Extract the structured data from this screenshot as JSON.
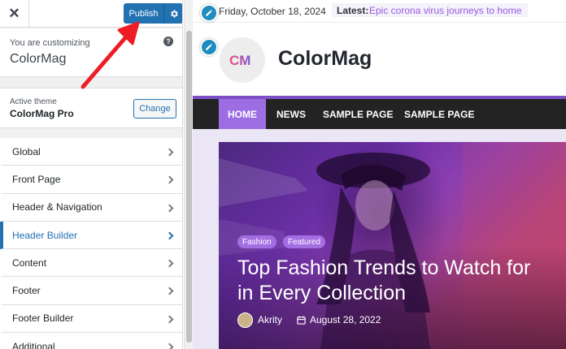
{
  "sidebar": {
    "close_icon": "close-icon",
    "publish_label": "Publish",
    "publish_settings_icon": "gear-icon",
    "customizing_label": "You are customizing",
    "site_name": "ColorMag",
    "help_icon": "help-icon",
    "active_theme_label": "Active theme",
    "theme_name": "ColorMag Pro",
    "change_label": "Change",
    "menu": [
      {
        "label": "Global"
      },
      {
        "label": "Front Page"
      },
      {
        "label": "Header & Navigation"
      },
      {
        "label": "Header Builder",
        "active": true
      },
      {
        "label": "Content"
      },
      {
        "label": "Footer"
      },
      {
        "label": "Footer Builder"
      },
      {
        "label": "Additional"
      }
    ]
  },
  "preview": {
    "date": "Friday, October 18, 2024",
    "latest_label": "Latest:",
    "latest_link": "Epic corona virus journeys to home",
    "site_title": "ColorMag",
    "logo_letters": "CM",
    "nav": [
      "HOME",
      "NEWS",
      "SAMPLE PAGE",
      "SAMPLE PAGE"
    ],
    "hero": {
      "tags": [
        "Fashion",
        "Featured"
      ],
      "title": "Top Fashion Trends to Watch for in Every Collection",
      "author": "Akrity",
      "date": "August 28, 2022"
    }
  },
  "colors": {
    "wp_blue": "#2271b1",
    "accent_purple": "#9d6ee3",
    "arrow_red": "#ee1c25"
  }
}
